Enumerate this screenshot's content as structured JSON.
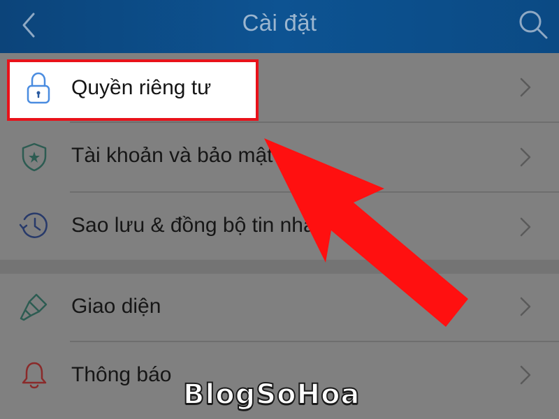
{
  "header": {
    "title": "Cài đặt",
    "back_icon": "chevron-left-icon",
    "search_icon": "search-icon"
  },
  "settings": {
    "group1": [
      {
        "label": "Quyền riêng tư",
        "icon": "lock-icon",
        "highlighted": true
      },
      {
        "label": "Tài khoản và bảo mật",
        "icon": "shield-star-icon"
      },
      {
        "label": "Sao lưu & đồng bộ tin nhắn",
        "icon": "clock-history-icon"
      }
    ],
    "group2": [
      {
        "label": "Giao diện",
        "icon": "paint-brush-icon"
      },
      {
        "label": "Thông báo",
        "icon": "bell-icon"
      }
    ]
  },
  "annotation": {
    "highlight_color": "#e8121a",
    "arrow_color": "#ff1010"
  },
  "watermark": {
    "text": "BlogSoHoa"
  },
  "colors": {
    "header_bg": "#0d4f8c",
    "header_text": "#9cb6cf",
    "dim_overlay_bg": "#808080"
  }
}
